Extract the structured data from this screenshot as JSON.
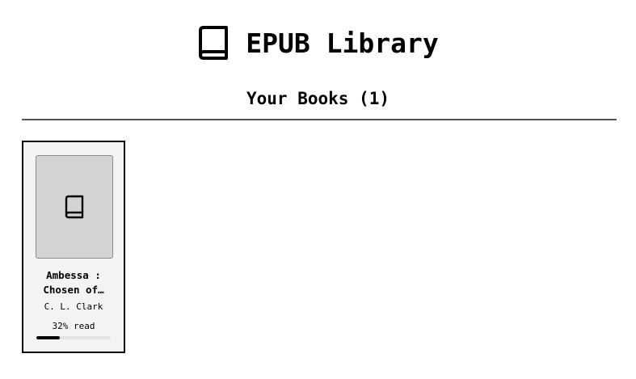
{
  "header": {
    "icon": "book-icon",
    "title": "EPUB Library"
  },
  "library": {
    "section_title": "Your Books (1)",
    "books": [
      {
        "cover_icon": "book-icon",
        "title_line1": "Ambessa :",
        "title_line2": "Chosen of…",
        "author": "C. L. Clark",
        "progress_label": "32% read",
        "progress_fraction": 0.32
      }
    ]
  },
  "colors": {
    "background": "#ffffff",
    "card_background": "#f3f3f3",
    "cover_background": "#d3d3d3",
    "progress_fill": "#000000",
    "progress_track": "#e4e4e4"
  }
}
